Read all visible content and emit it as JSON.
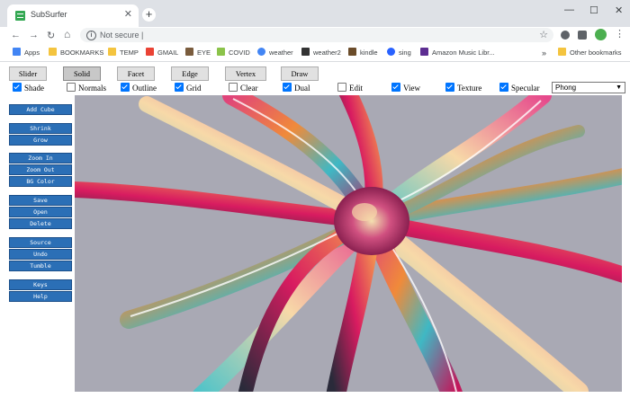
{
  "browser": {
    "tab_title": "SubSurfer",
    "tab_close": "✕",
    "new_tab": "+",
    "window_controls": [
      "—",
      "☐",
      "✕"
    ],
    "nav": {
      "back": "←",
      "forward": "→",
      "reload": "↻",
      "home": "⌂"
    },
    "address": {
      "security": "Not secure",
      "url_text": "Not secure  |"
    },
    "bookmarks": [
      {
        "label": "Apps",
        "icon": "apps-grid-icon",
        "color": "#4285f4"
      },
      {
        "label": "BOOKMARKS",
        "icon": "folder-icon",
        "color": "#f4c43f"
      },
      {
        "label": "TEMP",
        "icon": "folder-icon",
        "color": "#f4c43f"
      },
      {
        "label": "GMAIL",
        "icon": "gmail-icon",
        "color": "#ea4335"
      },
      {
        "label": "EYE",
        "icon": "image-icon",
        "color": "#7a5c3d"
      },
      {
        "label": "COVID",
        "icon": "covid-icon",
        "color": "#8bc34a"
      },
      {
        "label": "weather",
        "icon": "google-icon",
        "color": "#4285f4"
      },
      {
        "label": "weather2",
        "icon": "weather-icon",
        "color": "#333333"
      },
      {
        "label": "kindle",
        "icon": "kindle-icon",
        "color": "#6b4c2a"
      },
      {
        "label": "sing",
        "icon": "sing-icon",
        "color": "#2962ff"
      },
      {
        "label": "Amazon Music Libr...",
        "icon": "music-icon",
        "color": "#5c2d91"
      }
    ],
    "more_bookmarks": "»",
    "other_bookmarks": "Other bookmarks"
  },
  "app": {
    "modes": [
      "Slider",
      "Solid",
      "Facet",
      "Edge",
      "Vertex",
      "Draw"
    ],
    "active_mode": "Solid",
    "options": [
      {
        "label": "Shade",
        "checked": true
      },
      {
        "label": "Normals",
        "checked": false
      },
      {
        "label": "Outline",
        "checked": true
      },
      {
        "label": "Grid",
        "checked": true
      },
      {
        "label": "Clear",
        "checked": false
      },
      {
        "label": "Dual",
        "checked": true
      },
      {
        "label": "Edit",
        "checked": false
      },
      {
        "label": "View",
        "checked": true
      },
      {
        "label": "Texture",
        "checked": true
      },
      {
        "label": "Specular",
        "checked": true
      }
    ],
    "shading_select": "Phong",
    "side_groups": [
      [
        "Add Cube"
      ],
      [
        "Shrink",
        "Grow"
      ],
      [
        "Zoom In",
        "Zoom Out",
        "BG Color"
      ],
      [
        "Save",
        "Open",
        "Delete"
      ],
      [
        "Source",
        "Undo",
        "Tumble"
      ],
      [
        "Keys",
        "Help"
      ]
    ],
    "canvas_bg": "#a9a9b4",
    "button_color": "#2b6fb6"
  }
}
